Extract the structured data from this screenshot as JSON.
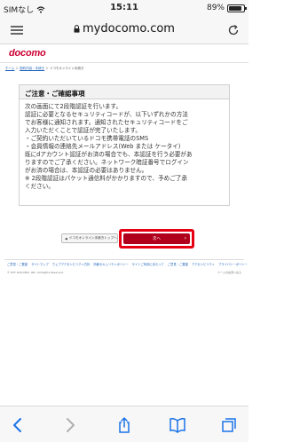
{
  "status": {
    "carrier": "SIMなし",
    "time": "15:11",
    "battery": "89%",
    "battery_level": 0.89
  },
  "browser": {
    "url": "mydocomo.com"
  },
  "logo": "docomo",
  "breadcrumb": {
    "home": "ホーム",
    "sep1": "＞",
    "procedures": "契約内容・手続き",
    "sep2": "＞",
    "current": "ドコモオンライン手続き"
  },
  "notice": {
    "heading": "ご注意・ご確認事項",
    "lines": [
      "次の画面にて2段階認証を行います。",
      "認証に必要となるセキュリティコードが、以下いずれかの方法",
      "でお客様に通知されます。通知されたセキュリティコードをご",
      "入力いただくことで認証が完了いたします。",
      "・ご契約いただいているドコモ携帯電話のSMS",
      "・会員情報の連絡先メールアドレス(Web または ケータイ)",
      "既にdアカウント認証がお済の場合でも、本認証を行う必要があ",
      "りますのでご了承ください。ネットワーク暗証番号でログイン",
      "がお済の場合は、本認証の必要はありません。",
      "※ 2段階認証はパケット通信料がかかりますので、予めご了承",
      "ください。"
    ]
  },
  "buttons": {
    "back": "ドコモオンライン手続きトップへ",
    "next": "次へ"
  },
  "footer": {
    "links": [
      "ご意見・ご要望",
      "サイトマップ",
      "ウェブアクセシビリティ方針",
      "情報セキュリティポリシー",
      "サイトご利用にあたって",
      "ご意見・ご要望",
      "アクセシビリティ",
      "プライバシーポリシー"
    ],
    "copyright": "© NTT DOCOMO, INC. All Rights Reserved.",
    "right_text": "ページの先頭へ戻る"
  },
  "icons": {
    "menu": "hamburger-menu-icon",
    "lock": "lock-icon",
    "reload": "reload-icon",
    "back": "back-arrow-icon",
    "forward": "forward-arrow-icon",
    "share": "share-icon",
    "bookmarks": "bookmarks-icon",
    "tabs": "tabs-icon"
  },
  "colors": {
    "brand": "#cc0033",
    "next_button": "#b0001c",
    "highlight": "#e60012",
    "link": "#2266bb"
  }
}
